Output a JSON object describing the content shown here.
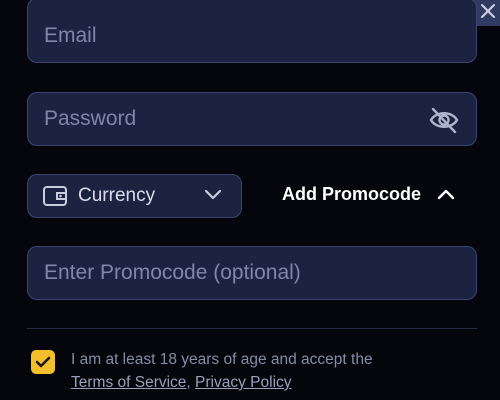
{
  "form": {
    "email_placeholder": "Email",
    "password_placeholder": "Password",
    "promocode_placeholder": "Enter Promocode (optional)"
  },
  "currency": {
    "label": "Currency",
    "icon": "wallet-icon"
  },
  "promocode": {
    "toggle_label": "Add Promocode",
    "icon": "chevron-up-icon"
  },
  "consent": {
    "text": "I am at least 18 years of age and accept the",
    "terms_label": "Terms of Service",
    "separator": ",",
    "privacy_label": "Privacy Policy",
    "checked": true
  },
  "colors": {
    "background": "#05060b",
    "field_bg": "#1c2340",
    "field_border": "#3a4470",
    "accent": "#f3c02b"
  }
}
